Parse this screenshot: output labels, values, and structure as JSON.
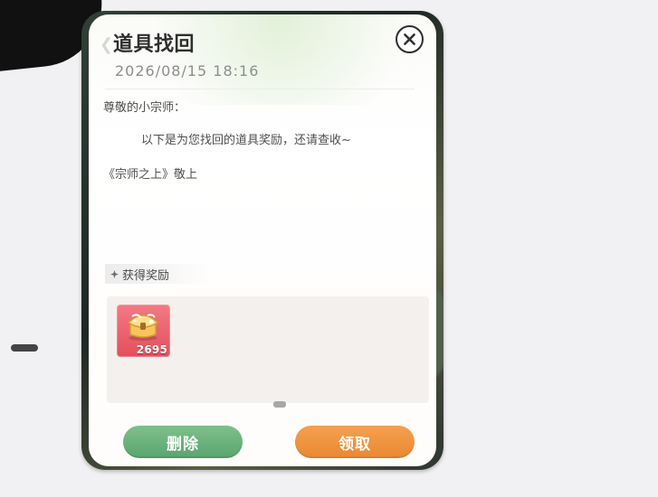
{
  "mail": {
    "title": "道具找回",
    "date": "2026/08/15 18:16",
    "greeting": "尊敬的小宗师：",
    "body": "以下是为您找回的道具奖励，还请查收~",
    "signature": "《宗师之上》敬上"
  },
  "rewards": {
    "heading": "获得奖励",
    "items": [
      {
        "icon": "treasure-chest-icon",
        "count": "2695"
      }
    ]
  },
  "actions": {
    "delete_label": "删除",
    "claim_label": "领取"
  },
  "colors": {
    "delete_button": "#67ad79",
    "claim_button": "#ef9540",
    "reward_background": "#e95d67"
  }
}
